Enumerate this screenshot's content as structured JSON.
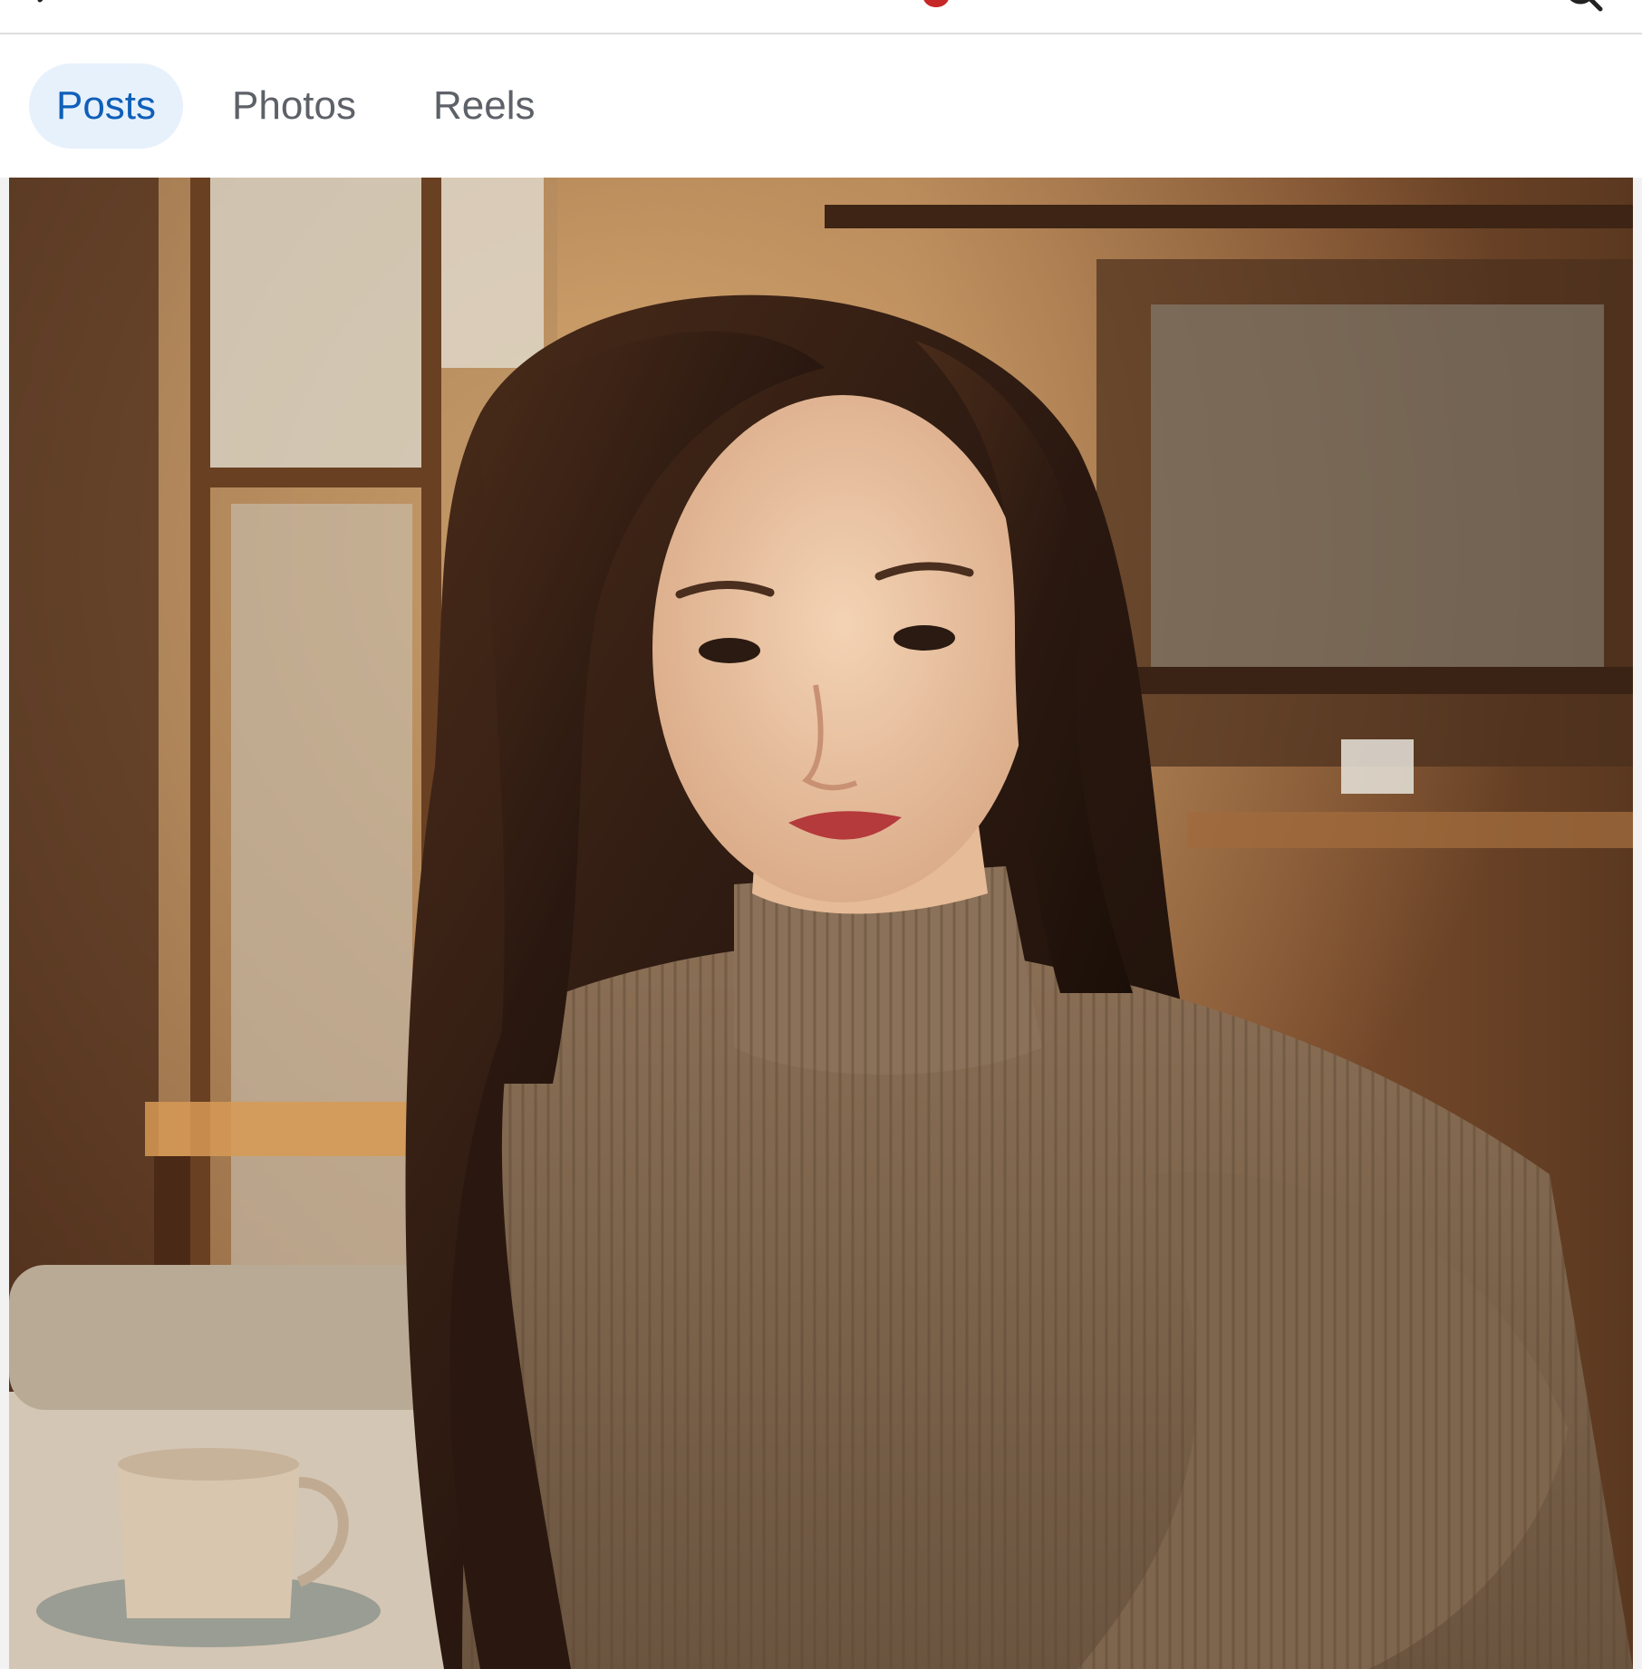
{
  "header": {
    "back_icon": "back-arrow-icon",
    "logo_icon": "app-logo-icon",
    "search_icon": "search-icon",
    "logo_color": "#c62828"
  },
  "tabs": [
    {
      "label": "Posts",
      "active": true
    },
    {
      "label": "Photos",
      "active": false
    },
    {
      "label": "Reels",
      "active": false
    }
  ],
  "post": {
    "image_subject": "woman in brown turtleneck sweater seated at a cafe table with a coffee cup"
  },
  "colors": {
    "tab_active_bg": "#e7f1fc",
    "tab_active_text": "#0f5fb8",
    "tab_inactive_text": "#5d6168",
    "divider": "#dedede"
  }
}
